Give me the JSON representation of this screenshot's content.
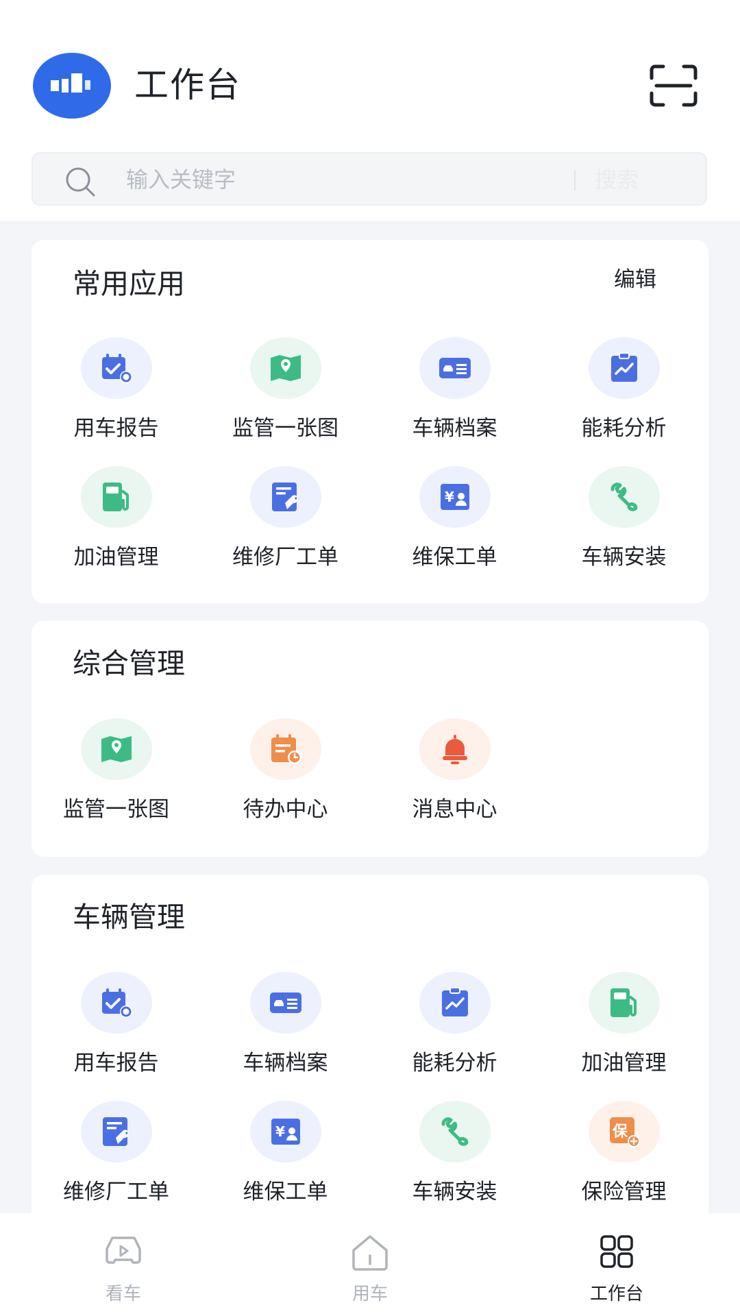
{
  "header": {
    "title": "工作台",
    "search_placeholder": "输入关键字",
    "search_button": "搜索"
  },
  "sections": [
    {
      "title": "常用应用",
      "action": "编辑",
      "items": [
        {
          "label": "用车报告",
          "icon": "calendar-gear-icon",
          "bg": "#edf1fd",
          "color": "#4a6fe3"
        },
        {
          "label": "监管一张图",
          "icon": "map-pin-icon",
          "bg": "#e9f7f0",
          "color": "#3dbb84"
        },
        {
          "label": "车辆档案",
          "icon": "vehicle-card-icon",
          "bg": "#edf1fd",
          "color": "#4a6fe3"
        },
        {
          "label": "能耗分析",
          "icon": "chart-clipboard-icon",
          "bg": "#edf1fd",
          "color": "#4a6fe3"
        },
        {
          "label": "加油管理",
          "icon": "fuel-pump-icon",
          "bg": "#e9f7f0",
          "color": "#3dbb84"
        },
        {
          "label": "维修厂工单",
          "icon": "repair-order-icon",
          "bg": "#edf1fd",
          "color": "#4a6fe3"
        },
        {
          "label": "维保工单",
          "icon": "maintenance-order-icon",
          "bg": "#edf1fd",
          "color": "#4a6fe3"
        },
        {
          "label": "车辆安装",
          "icon": "wrench-icon",
          "bg": "#e9f7f0",
          "color": "#3dbb84"
        }
      ]
    },
    {
      "title": "综合管理",
      "items": [
        {
          "label": "监管一张图",
          "icon": "map-pin-icon",
          "bg": "#e9f7f0",
          "color": "#3dbb84"
        },
        {
          "label": "待办中心",
          "icon": "todo-calendar-icon",
          "bg": "#fdf1ea",
          "color": "#ef8d4a"
        },
        {
          "label": "消息中心",
          "icon": "alarm-bell-icon",
          "bg": "#fdf1ea",
          "color": "#ea5a3c"
        }
      ]
    },
    {
      "title": "车辆管理",
      "items": [
        {
          "label": "用车报告",
          "icon": "calendar-gear-icon",
          "bg": "#edf1fd",
          "color": "#4a6fe3"
        },
        {
          "label": "车辆档案",
          "icon": "vehicle-card-icon",
          "bg": "#edf1fd",
          "color": "#4a6fe3"
        },
        {
          "label": "能耗分析",
          "icon": "chart-clipboard-icon",
          "bg": "#edf1fd",
          "color": "#4a6fe3"
        },
        {
          "label": "加油管理",
          "icon": "fuel-pump-icon",
          "bg": "#e9f7f0",
          "color": "#3dbb84"
        },
        {
          "label": "维修厂工单",
          "icon": "repair-order-icon",
          "bg": "#edf1fd",
          "color": "#4a6fe3"
        },
        {
          "label": "维保工单",
          "icon": "maintenance-order-icon",
          "bg": "#edf1fd",
          "color": "#4a6fe3"
        },
        {
          "label": "车辆安装",
          "icon": "wrench-icon",
          "bg": "#e9f7f0",
          "color": "#3dbb84"
        },
        {
          "label": "保险管理",
          "icon": "insurance-icon",
          "bg": "#fdf1ea",
          "color": "#ef8d4a"
        }
      ]
    }
  ],
  "tabbar": {
    "items": [
      {
        "label": "看车",
        "icon": "car-view-icon",
        "active": false
      },
      {
        "label": "用车",
        "icon": "home-icon",
        "active": false
      },
      {
        "label": "工作台",
        "icon": "grid-icon",
        "active": true
      }
    ]
  },
  "colors": {
    "accent": "#2f6be8",
    "background": "#f3f5f9",
    "tab_active": "#1f2329",
    "tab_inactive": "#b0b4bb"
  }
}
